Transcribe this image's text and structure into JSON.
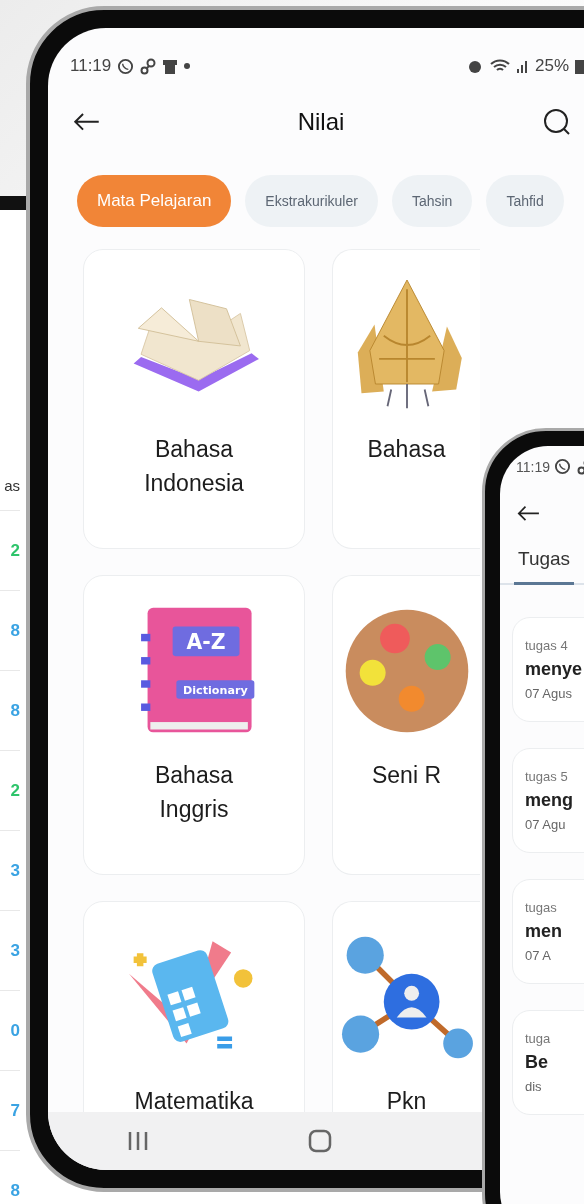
{
  "back_phone": {
    "column_header": "as",
    "values": [
      {
        "text": "2",
        "color": "#2ec46b"
      },
      {
        "text": "8",
        "color": "#3aa3e3"
      },
      {
        "text": "8",
        "color": "#3aa3e3"
      },
      {
        "text": "2",
        "color": "#2ec46b"
      },
      {
        "text": "3",
        "color": "#3aa3e3"
      },
      {
        "text": "3",
        "color": "#3aa3e3"
      },
      {
        "text": "0",
        "color": "#3aa3e3"
      },
      {
        "text": "7",
        "color": "#3aa3e3"
      },
      {
        "text": "8",
        "color": "#3aa3e3"
      }
    ]
  },
  "main_phone": {
    "status_bar": {
      "time": "11:19",
      "battery": "25%"
    },
    "header": {
      "title": "Nilai"
    },
    "tabs": [
      {
        "label": "Mata Pelajaran",
        "selected": true
      },
      {
        "label": "Ekstrakurikuler",
        "selected": false
      },
      {
        "label": "Tahsin",
        "selected": false
      },
      {
        "label": "Tahfid",
        "selected": false
      }
    ],
    "subjects": [
      {
        "name": "Bahasa Indonesia",
        "kind": "book"
      },
      {
        "name": "Bahasa",
        "kind": "wayang"
      },
      {
        "name": "Bahasa Inggris",
        "kind": "dictionary",
        "cover_texts": [
          "A-Z",
          "Dictionary"
        ]
      },
      {
        "name": "Seni R",
        "kind": "palette"
      },
      {
        "name": "Matematika",
        "kind": "calculator"
      },
      {
        "name": "Pkn",
        "kind": "network"
      }
    ]
  },
  "front_phone": {
    "status_bar": {
      "time": "11:19"
    },
    "tabs": [
      {
        "label": "Tugas",
        "selected": true
      }
    ],
    "assignments": [
      {
        "label": "tugas 4",
        "title": "menye",
        "date": "07 Agus"
      },
      {
        "label": "tugas 5",
        "title": "meng",
        "date": "07 Agu"
      },
      {
        "label": "tugas",
        "title": "men",
        "date": "07 A"
      },
      {
        "label": "tuga",
        "title": "Be",
        "date": "dis"
      }
    ]
  }
}
